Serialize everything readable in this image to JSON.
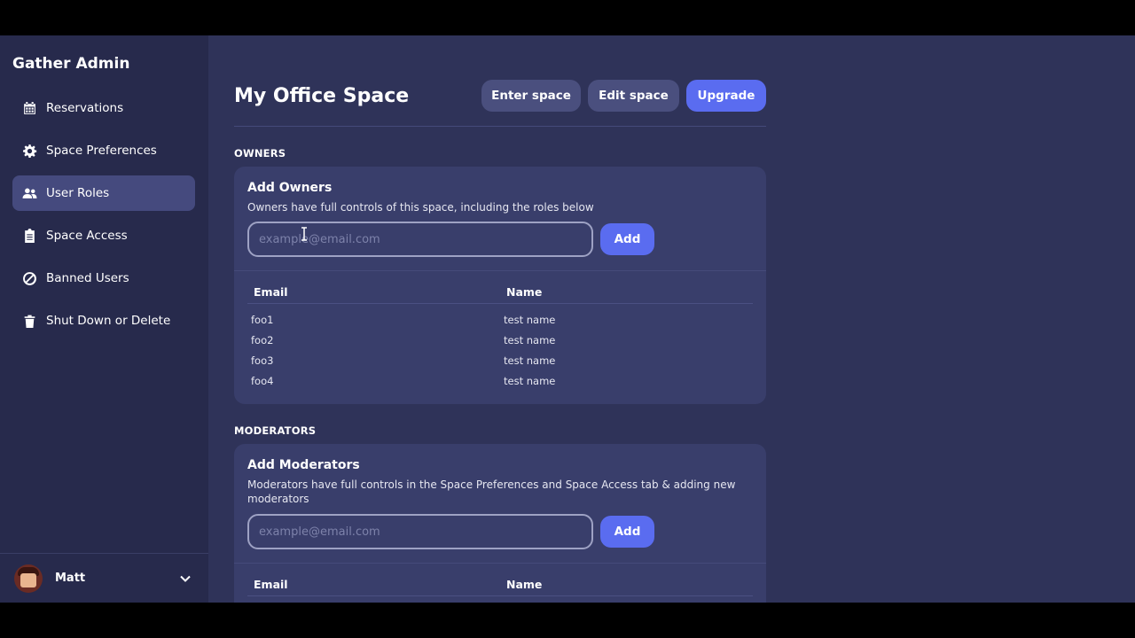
{
  "sidebar": {
    "brand": "Gather Admin",
    "items": [
      {
        "label": "Reservations",
        "icon": "calendar-icon"
      },
      {
        "label": "Space Preferences",
        "icon": "gear-icon"
      },
      {
        "label": "User Roles",
        "icon": "users-icon",
        "active": true
      },
      {
        "label": "Space Access",
        "icon": "clipboard-icon"
      },
      {
        "label": "Banned Users",
        "icon": "ban-icon"
      },
      {
        "label": "Shut Down or Delete",
        "icon": "trash-icon"
      }
    ],
    "user": {
      "name": "Matt"
    }
  },
  "header": {
    "title": "My Office Space",
    "buttons": {
      "enter": "Enter space",
      "edit": "Edit space",
      "upgrade": "Upgrade"
    }
  },
  "owners": {
    "section_label": "OWNERS",
    "title": "Add Owners",
    "description": "Owners have full controls of this space, including the roles below",
    "input_placeholder": "example@email.com",
    "add_label": "Add",
    "columns": [
      "Email",
      "Name"
    ],
    "rows": [
      {
        "email": "foo1",
        "name": "test name"
      },
      {
        "email": "foo2",
        "name": "test name"
      },
      {
        "email": "foo3",
        "name": "test name"
      },
      {
        "email": "foo4",
        "name": "test name"
      }
    ]
  },
  "moderators": {
    "section_label": "MODERATORS",
    "title": "Add Moderators",
    "description": "Moderators have full controls in the Space Preferences and Space Access tab & adding new moderators",
    "input_placeholder": "example@email.com",
    "add_label": "Add",
    "columns": [
      "Email",
      "Name"
    ]
  },
  "colors": {
    "background": "#2f3359",
    "sidebar": "#272a4c",
    "card": "#393e6b",
    "primary": "#5a6cf0",
    "secondary_button": "#4a4f7e",
    "active_nav": "#454a7e"
  }
}
